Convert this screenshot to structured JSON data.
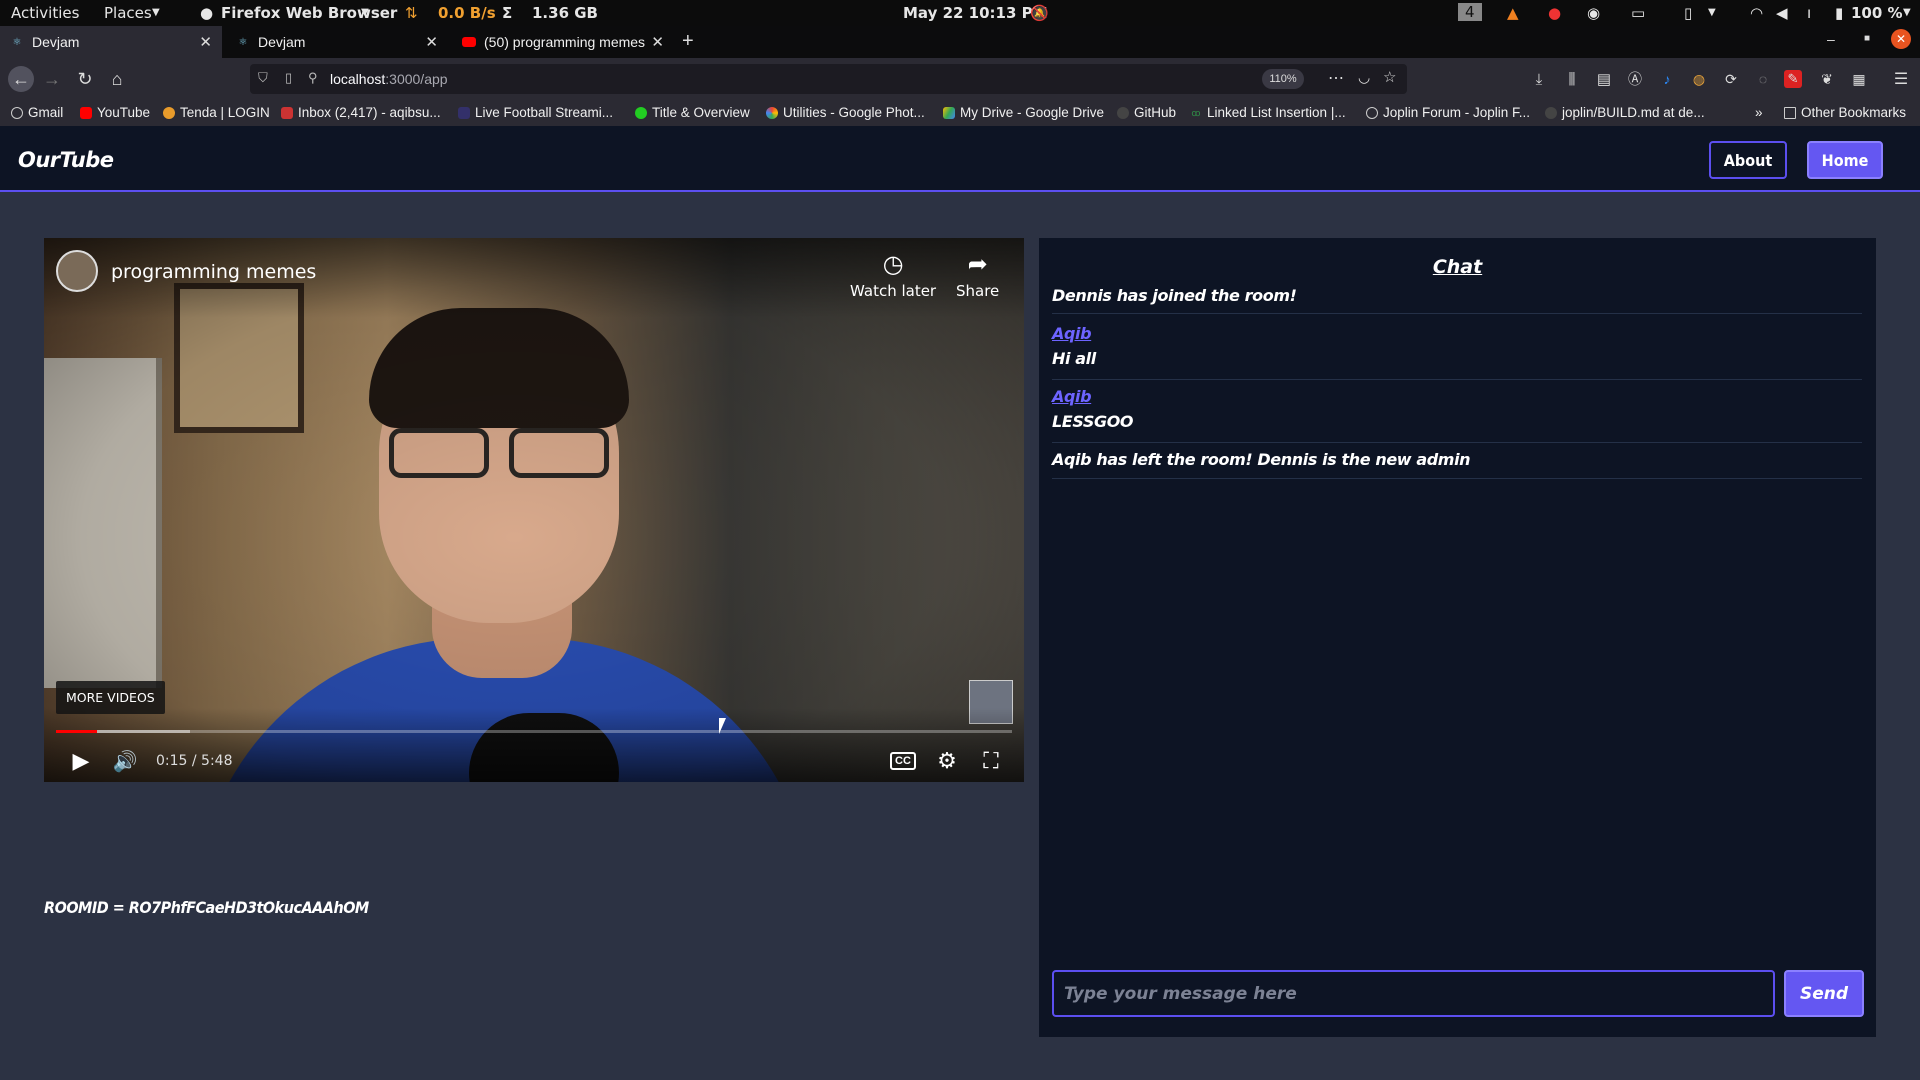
{
  "gnome": {
    "activities": "Activities",
    "places": "Places",
    "app_menu": "Firefox Web Browser",
    "net_speed": "0.0 B/s",
    "sigma": "Σ",
    "mem": "1.36 GB",
    "datetime": "May 22  10:13 PM",
    "workspace": "4",
    "battery": "100 %"
  },
  "tabs": [
    {
      "label": "Devjam"
    },
    {
      "label": "Devjam"
    },
    {
      "label": "(50) programming memes -"
    }
  ],
  "urlbar": {
    "host": "localhost",
    "path": ":3000/app",
    "zoom": "110%"
  },
  "bookmarks": [
    {
      "label": "Gmail"
    },
    {
      "label": "YouTube"
    },
    {
      "label": "Tenda | LOGIN"
    },
    {
      "label": "Inbox (2,417) - aqibsu..."
    },
    {
      "label": "Live Football Streami..."
    },
    {
      "label": "Title & Overview"
    },
    {
      "label": "Utilities - Google Phot..."
    },
    {
      "label": "My Drive - Google Drive"
    },
    {
      "label": "GitHub"
    },
    {
      "label": "Linked List Insertion |..."
    },
    {
      "label": "Joplin Forum - Joplin F..."
    },
    {
      "label": "joplin/BUILD.md at de..."
    },
    {
      "label": "Other Bookmarks"
    }
  ],
  "app": {
    "brand": "OurTube",
    "about": "About",
    "home": "Home",
    "roomid": "ROOMID = RO7PhfFCaeHD3tOkucAAAhOM"
  },
  "video": {
    "title": "programming memes",
    "watch_later": "Watch later",
    "share": "Share",
    "more_videos": "MORE VIDEOS",
    "time": "0:15 / 5:48",
    "progress": 0.043
  },
  "chat": {
    "title": "Chat",
    "messages": [
      {
        "user": "",
        "text": "Dennis has joined the room!"
      },
      {
        "user": "Aqib",
        "text": "Hi all"
      },
      {
        "user": "Aqib",
        "text": "LESSGOO"
      },
      {
        "user": "",
        "text": "Aqib has left the room! Dennis is the new admin"
      }
    ],
    "placeholder": "Type your message here",
    "send": "Send"
  }
}
